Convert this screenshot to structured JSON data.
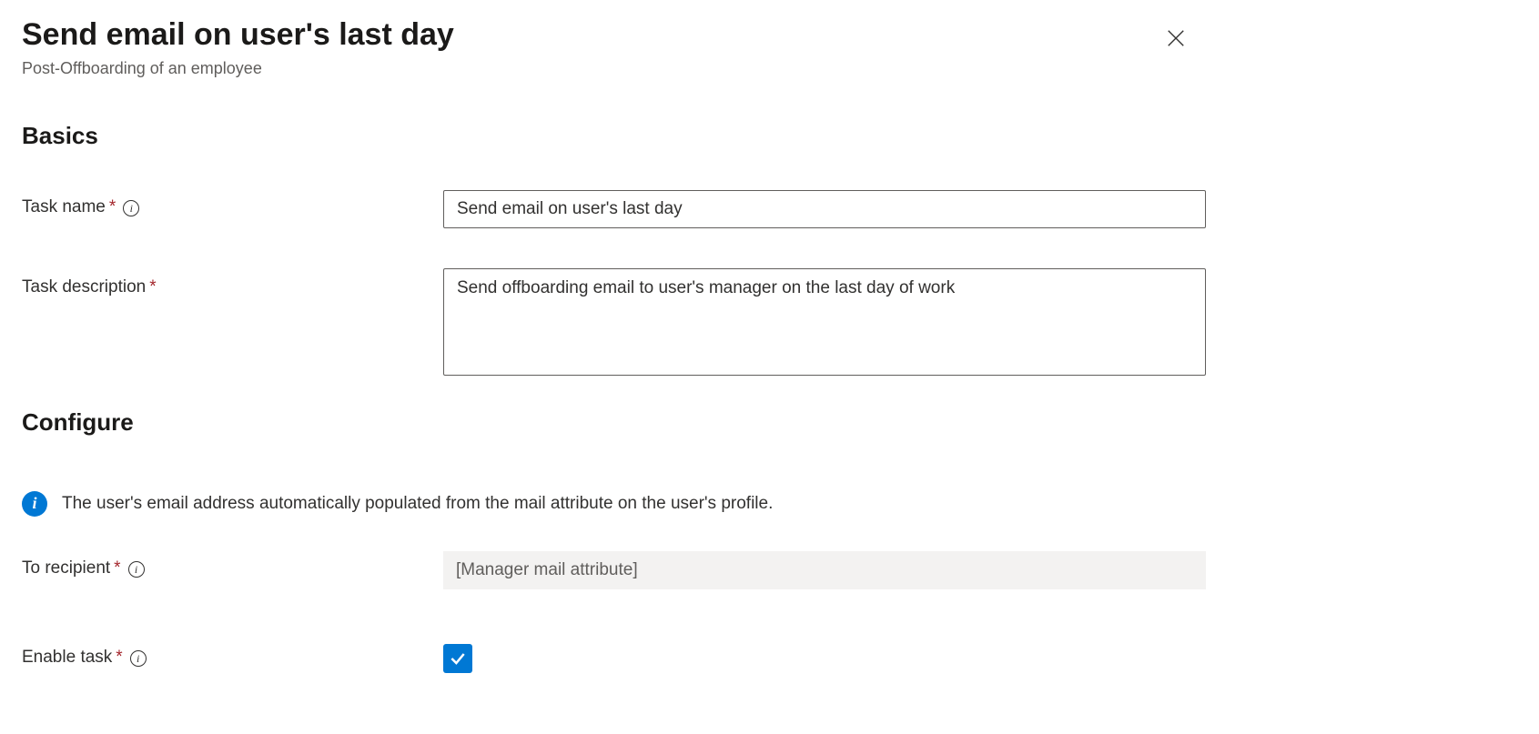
{
  "header": {
    "title": "Send email on user's last day",
    "subtitle": "Post-Offboarding of an employee"
  },
  "sections": {
    "basics": {
      "heading": "Basics"
    },
    "configure": {
      "heading": "Configure"
    }
  },
  "basics": {
    "task_name": {
      "label": "Task name",
      "value": "Send email on user's last day"
    },
    "task_description": {
      "label": "Task description",
      "value": "Send offboarding email to user's manager on the last day of work"
    }
  },
  "configure": {
    "info_text": "The user's email address automatically populated from the mail attribute on the user's profile.",
    "to_recipient": {
      "label": "To recipient",
      "value": "[Manager mail attribute]"
    },
    "enable_task": {
      "label": "Enable task",
      "checked": true
    }
  }
}
